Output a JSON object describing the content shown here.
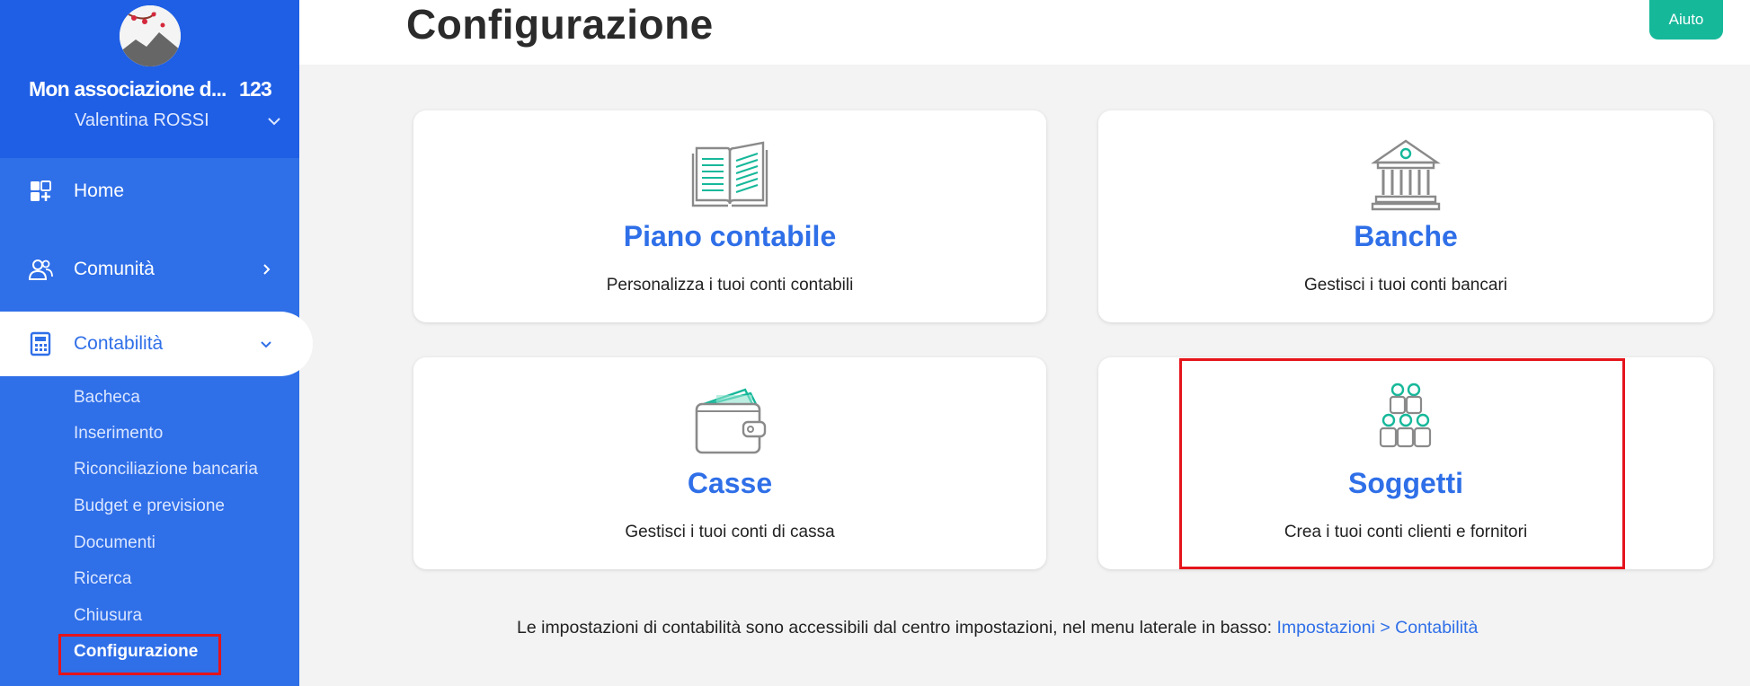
{
  "sidebar": {
    "org_name": "Mon associazione d...",
    "org_code": "123",
    "user_name": "Valentina ROSSI",
    "nav": [
      {
        "label": "Home",
        "icon": "dashboard-icon"
      },
      {
        "label": "Comunità",
        "icon": "people-icon"
      },
      {
        "label": "Contabilità",
        "icon": "calculator-icon"
      }
    ],
    "sub_items": [
      "Bacheca",
      "Inserimento",
      "Riconciliazione bancaria",
      "Budget e previsione",
      "Documenti",
      "Ricerca",
      "Chiusura",
      "Configurazione"
    ]
  },
  "header": {
    "title": "Configurazione",
    "help_label": "Aiuto"
  },
  "cards": [
    {
      "title": "Piano contabile",
      "desc": "Personalizza i tuoi conti contabili",
      "icon": "book-icon"
    },
    {
      "title": "Banche",
      "desc": "Gestisci i tuoi conti bancari",
      "icon": "bank-icon"
    },
    {
      "title": "Casse",
      "desc": "Gestisci i tuoi conti di cassa",
      "icon": "wallet-icon"
    },
    {
      "title": "Soggetti",
      "desc": "Crea i tuoi conti clienti e fornitori",
      "icon": "people-group-icon"
    }
  ],
  "footer": {
    "text": "Le impostazioni di contabilità sono accessibili dal centro impostazioni, nel menu laterale in basso: ",
    "link": "Impostazioni > Contabilità"
  },
  "colors": {
    "sidebar": "#2f6fe8",
    "accent": "#2f6fe8",
    "help_button": "#16b89a",
    "highlight": "#e5141b"
  }
}
